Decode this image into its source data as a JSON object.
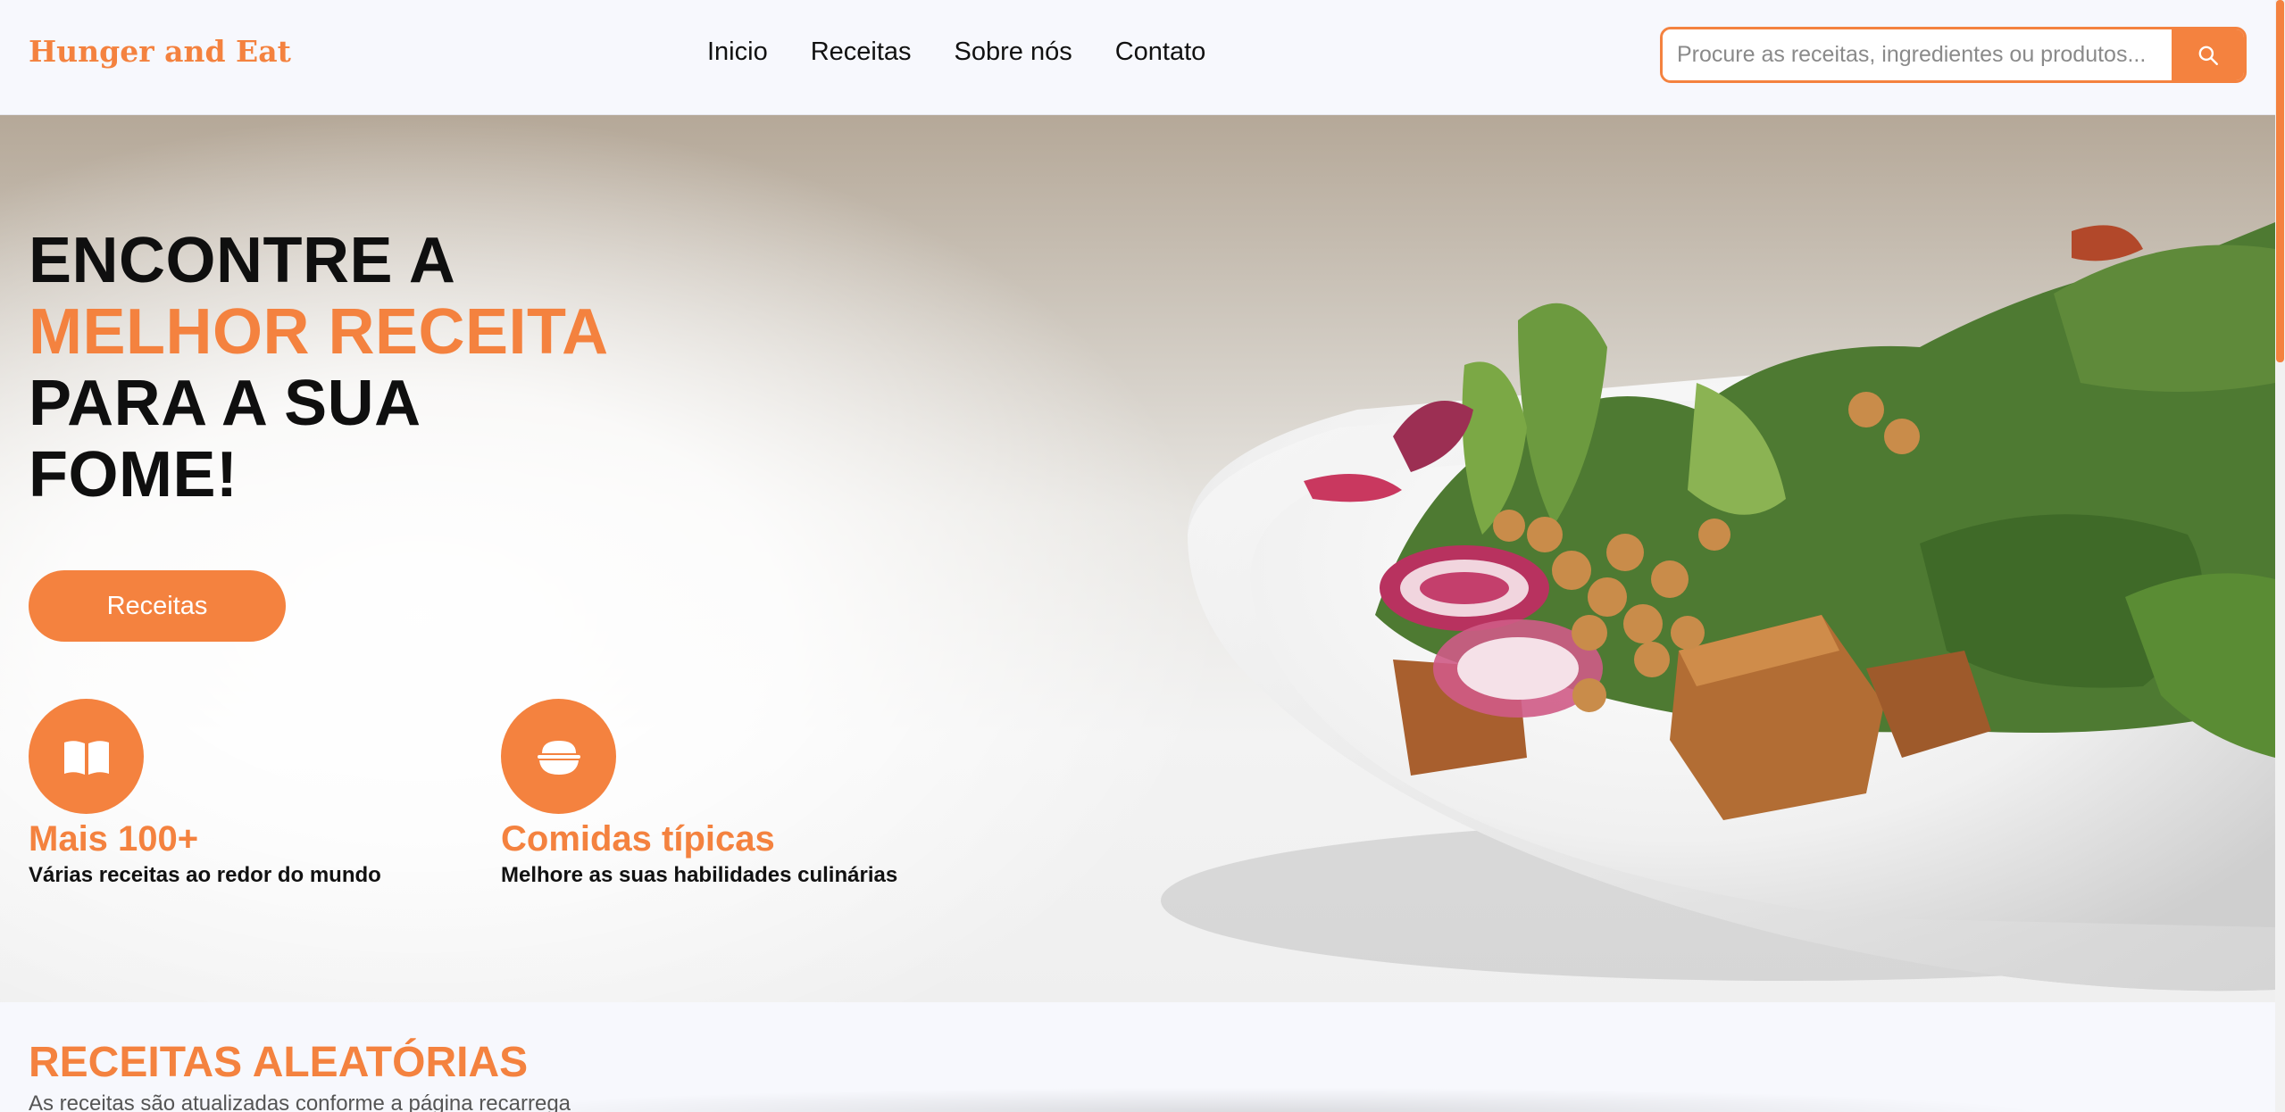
{
  "brand": {
    "logo": "Hunger and Eat",
    "accent_color": "#f4823f"
  },
  "nav": {
    "items": [
      {
        "label": "Inicio"
      },
      {
        "label": "Receitas"
      },
      {
        "label": "Sobre nós"
      },
      {
        "label": "Contato"
      }
    ]
  },
  "search": {
    "placeholder": "Procure as receitas, ingredientes ou produtos...",
    "value": "",
    "button_icon": "search-icon"
  },
  "hero": {
    "title_line1": "ENCONTRE A",
    "title_accent": "MELHOR RECEITA",
    "title_line3": "PARA A SUA",
    "title_line4": "FOME!",
    "cta_label": "Receitas",
    "image": "salad-bowl-photo",
    "features": [
      {
        "icon": "open-book-icon",
        "title": "Mais 100+",
        "description": "Várias receitas ao redor do mundo"
      },
      {
        "icon": "rice-bowl-icon",
        "title": "Comidas típicas",
        "description": "Melhore as suas habilidades culinárias"
      }
    ]
  },
  "random_recipes": {
    "title": "RECEITAS ALEATÓRIAS",
    "subtitle": "As receitas são atualizadas conforme a página recarrega"
  }
}
